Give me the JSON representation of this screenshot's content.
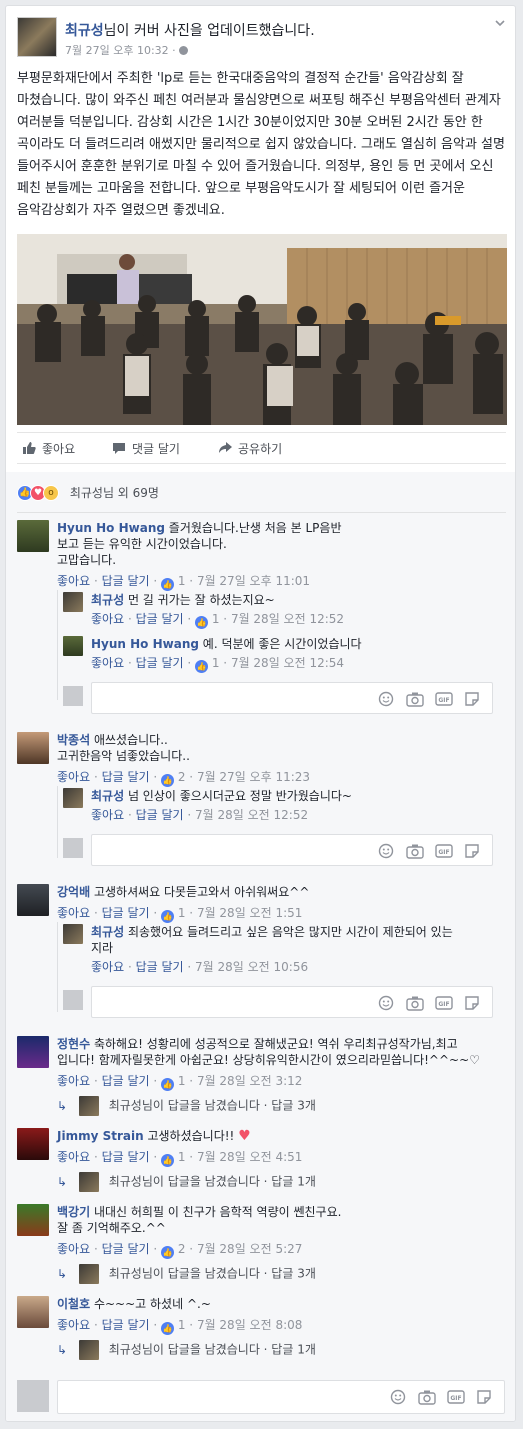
{
  "post": {
    "author": "최규성",
    "headline_rest": "님이 커버 사진을 업데이트했습니다.",
    "date": "7월 27일 오후 10:32",
    "privacy_sep": "·",
    "text": "부평문화재단에서 주최한 'lp로 듣는 한국대중음악의 결정적 순간들' 음악감상회 잘 마쳤습니다. 많이 와주신 페친 여러분과 물심양면으로 써포팅 해주신 부평음악센터 관계자 여러분들 덕분입니다. 감상회 시간은 1시간 30분이었지만 30분 오버된 2시간 동안 한 곡이라도 더 들려드리려 애썼지만 물리적으로 쉽지 않았습니다. 그래도 열심히 음악과 설명 들어주시어 훈훈한 분위기로 마칠 수 있어 즐거웠습니다. 의정부, 용인 등 먼 곳에서 오신 페친 분들께는 고마움을 전합니다. 앞으로 부평음악도시가 잘 세팅되어 이런 즐거운 음악감상회가 자주 열렸으면 좋겠네요."
  },
  "actions": {
    "like": "좋아요",
    "comment": "댓글 달기",
    "share": "공유하기"
  },
  "reactions": {
    "summary": "최규성님 외 69명"
  },
  "labels": {
    "like": "좋아요",
    "reply": "답글 달기",
    "dot": "·"
  },
  "comments": [
    {
      "author": "Hyun Ho Hwang",
      "text": "즐거웠습니다.난생 처음 본 LP음반",
      "text2": "보고 듣는 유익한 시간이었습니다.",
      "text3": "고맙습니다.",
      "likes": "1",
      "time": "7월 27일 오후 11:01",
      "replies": [
        {
          "author": "최규성",
          "text": "먼 길 귀가는 잘 하셨는지요~",
          "likes": "1",
          "time": "7월 28일 오전 12:52"
        },
        {
          "author": "Hyun Ho Hwang",
          "text": "예. 덕분에 좋은 시간이었습니다",
          "likes": "1",
          "time": "7월 28일 오전 12:54"
        }
      ]
    },
    {
      "author": "박종석",
      "text": "애쓰셨습니다..",
      "text2": "고귀한음악 넘좋았습니다..",
      "likes": "2",
      "time": "7월 27일 오후 11:23",
      "replies": [
        {
          "author": "최규성",
          "text": "넘 인상이 좋으시더군요 정말 반가웠습니다~",
          "time": "7월 28일 오전 12:52"
        }
      ]
    },
    {
      "author": "강억배",
      "text": "고생하셔써요 다못듣고와서 아쉬워써요^^",
      "likes": "1",
      "time": "7월 28일 오전 1:51",
      "replies": [
        {
          "author": "최규성",
          "text": "죄송했어요 들려드리고 싶은 음악은 많지만 시간이 제한되어 있는",
          "text2": "지라",
          "time": "7월 28일 오전 10:56"
        }
      ]
    },
    {
      "author": "정현수",
      "text": "축하해요! 성황리에 성공적으로 잘해냈군요! 역쉬 우리최규성작가님,최고",
      "text2": "입니다! 함께자릴못한게 아쉽군요! 상당히유익한시간이 였으리라믿씁니다!^^~~♡",
      "likes": "1",
      "time": "7월 28일 오전 3:12",
      "summary": "최규성님이 답글을 남겼습니다 · 답글 3개"
    },
    {
      "author": "Jimmy Strain",
      "text": "고생하셨습니다!!",
      "likes": "1",
      "time": "7월 28일 오전 4:51",
      "summary": "최규성님이 답글을 남겼습니다 · 답글 1개"
    },
    {
      "author": "백강기",
      "text": "내대신 허희필 이 친구가 음학적 역량이 쎈친구요.",
      "text2": "잘 좀 기억해주오.^^",
      "likes": "2",
      "time": "7월 28일 오전 5:27",
      "summary": "최규성님이 답글을 남겼습니다 · 답글 3개"
    },
    {
      "author": "이철호",
      "text": "수~~~고 하셨네 ^.~",
      "likes": "1",
      "time": "7월 28일 오전 8:08",
      "summary": "최규성님이 답글을 남겼습니다 · 답글 1개"
    }
  ],
  "colors": {
    "link": "#365899",
    "like_blue": "#4f7ff3",
    "love_red": "#f25268",
    "muted": "#90949c"
  }
}
